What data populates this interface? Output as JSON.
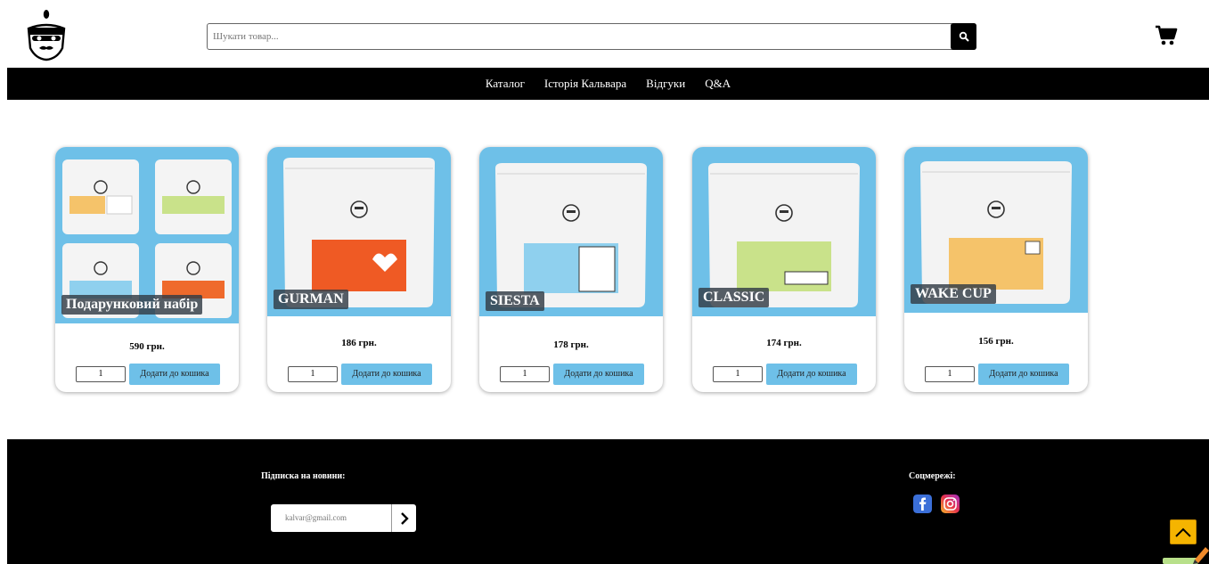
{
  "header": {
    "search_placeholder": "Шукати товар...",
    "logo_icon": "coffee-mascot-logo-icon",
    "search_icon": "search-icon",
    "cart_icon": "cart-icon"
  },
  "nav": {
    "items": [
      "Каталог",
      "Історія Кальвара",
      "Відгуки",
      "Q&A"
    ]
  },
  "products": [
    {
      "title": "Подарунковий набір",
      "price": "590 грн.",
      "qty": "1",
      "add_label": "Додати до кошика"
    },
    {
      "title": "GURMAN",
      "price": "186 грн.",
      "qty": "1",
      "add_label": "Додати до кошика"
    },
    {
      "title": "SIESTA",
      "price": "178 грн.",
      "qty": "1",
      "add_label": "Додати до кошика"
    },
    {
      "title": "CLASSIC",
      "price": "174 грн.",
      "qty": "1",
      "add_label": "Додати до кошика"
    },
    {
      "title": "WAKE CUP",
      "price": "156 грн.",
      "qty": "1",
      "add_label": "Додати до кошика"
    }
  ],
  "footer": {
    "subscribe_label": "Підписка на новини:",
    "email_placeholder": "kalvar@gmail.com",
    "social_label": "Соцмережі:"
  },
  "colors": {
    "accent_blue": "#6ec0e8",
    "top_button": "#f5b400"
  }
}
